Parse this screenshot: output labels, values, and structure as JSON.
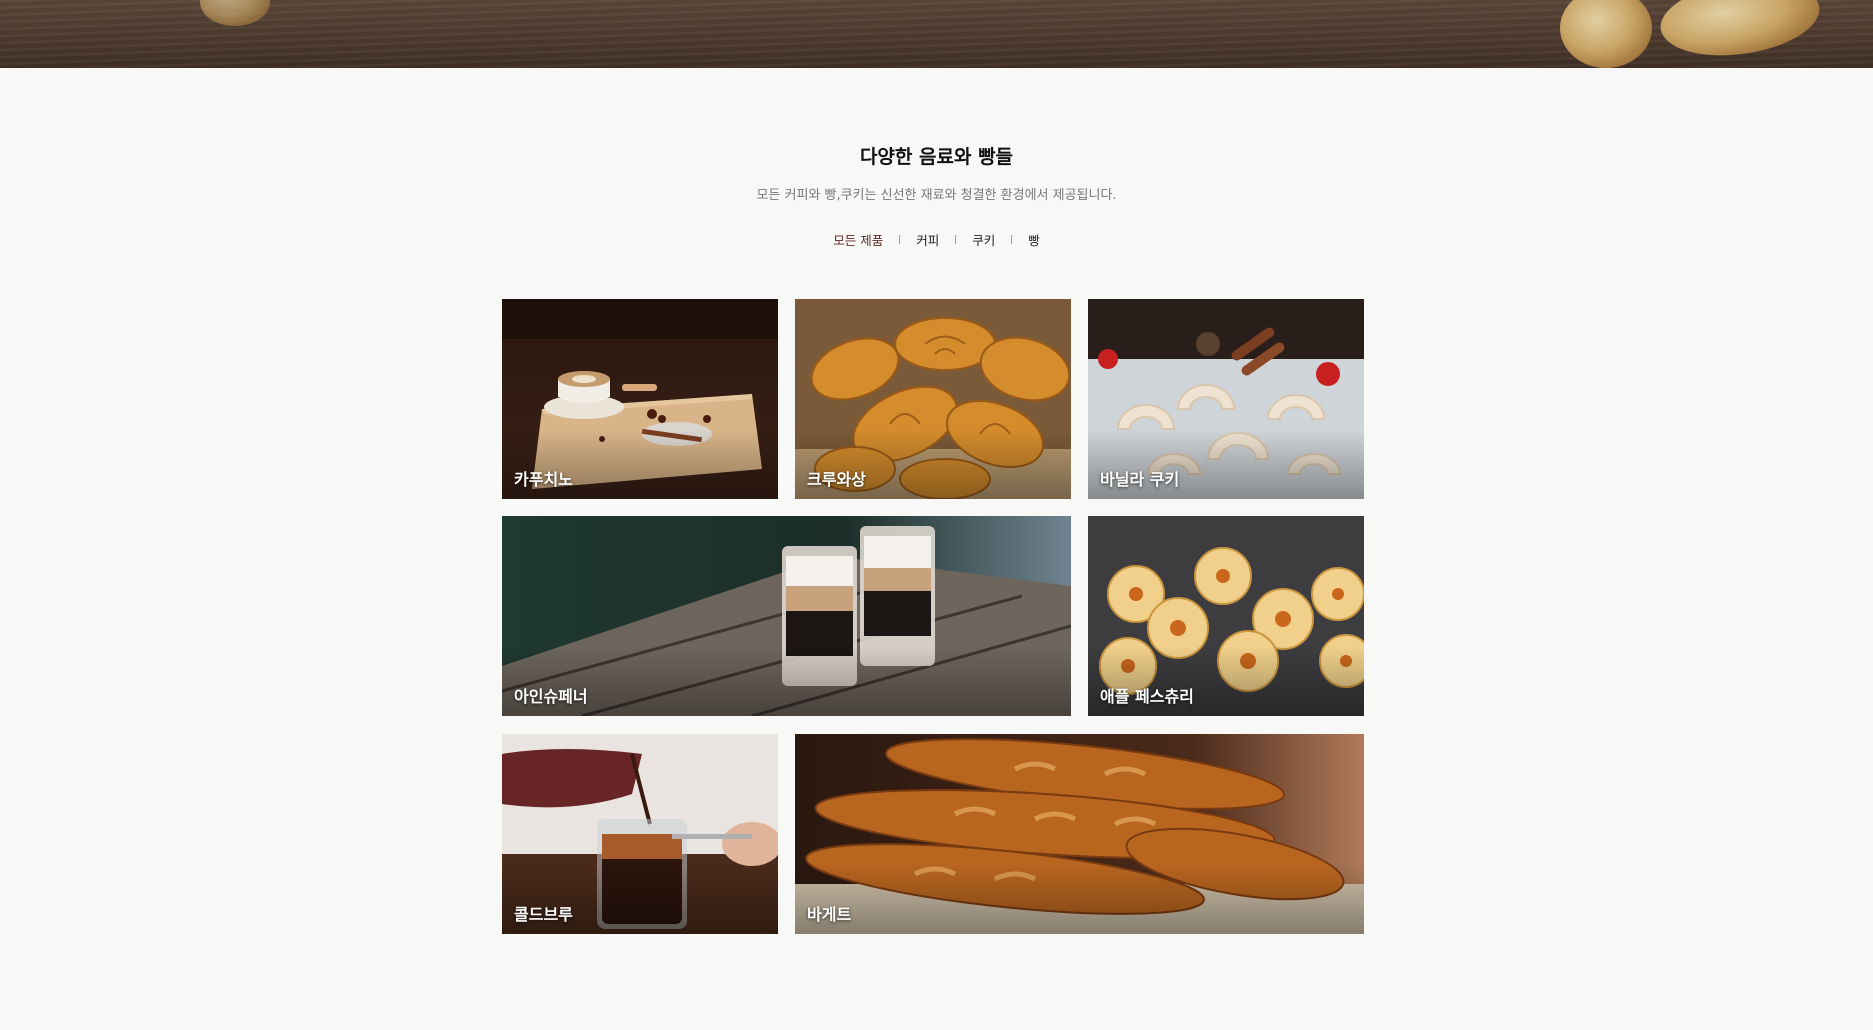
{
  "gallery": {
    "title": "다양한 음료와 빵들",
    "subtitle": "모든 커피와 빵,쿠키는 신선한 재료와 청결한 환경에서 제공됩니다.",
    "filters": [
      {
        "label": "모든 제품",
        "active": true
      },
      {
        "label": "커피",
        "active": false
      },
      {
        "label": "쿠키",
        "active": false
      },
      {
        "label": "빵",
        "active": false
      }
    ],
    "items": [
      {
        "label": "카푸치노"
      },
      {
        "label": "크루와상"
      },
      {
        "label": "바닐라 쿠키"
      },
      {
        "label": "아인슈페너"
      },
      {
        "label": "애플 페스츄리"
      },
      {
        "label": "콜드브루"
      },
      {
        "label": "바게트"
      }
    ]
  },
  "colors": {
    "page_background": "#f8f8f7",
    "banner_wood": "#4d3a2e",
    "filter_active": "#5b2a24"
  }
}
